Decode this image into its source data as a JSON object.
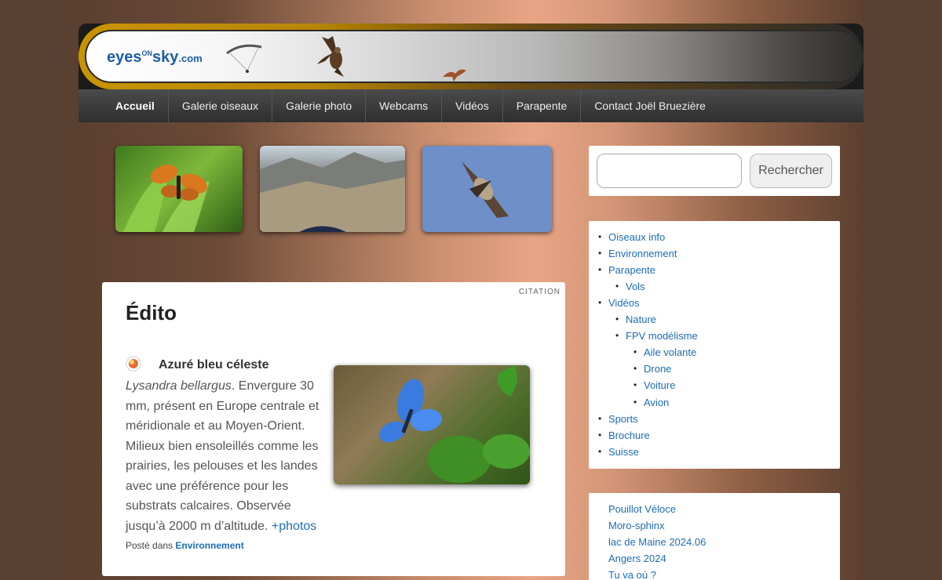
{
  "logo": {
    "brand": "eyes",
    "sup": "ON",
    "brand2": "sky",
    "tld": ".com"
  },
  "nav": {
    "items": [
      "Accueil",
      "Galerie oiseaux",
      "Galerie photo",
      "Webcams",
      "Vidéos",
      "Parapente",
      "Contact Joël Bruezière"
    ]
  },
  "article": {
    "format": "CITATION",
    "title": "Édito",
    "species": "Azuré bleu céleste",
    "latin": "Lysandra bellargus",
    "text": ". Envergure 30 mm, présent en Europe centrale et méridionale et au Moyen-Orient. Milieux bien ensoleillés comme les prairies, les pelouses et les landes avec une préférence pour les substrats calcaires. Observée jusqu’à 2000 m d’altitude. ",
    "more_link": "+photos",
    "posted_prefix": "Posté dans ",
    "posted_category": "Environnement"
  },
  "search": {
    "placeholder": "",
    "button": "Rechercher"
  },
  "categories": [
    "Oiseaux info",
    "Environnement",
    "Parapente",
    "Vols",
    "Vidéos",
    "Nature",
    "FPV modélisme",
    "Aile volante",
    "Drone",
    "Voiture",
    "Avion",
    "Sports",
    "Brochure",
    "Suisse"
  ],
  "recent": [
    "Pouillot Véloce",
    "Moro-sphinx",
    "lac de Maine 2024.06",
    "Angers 2024",
    "Tu va où ?"
  ],
  "colors": {
    "link": "#1d6cb5",
    "nav_bg": "#3a3a3a",
    "logo": "#1d5fa8"
  }
}
